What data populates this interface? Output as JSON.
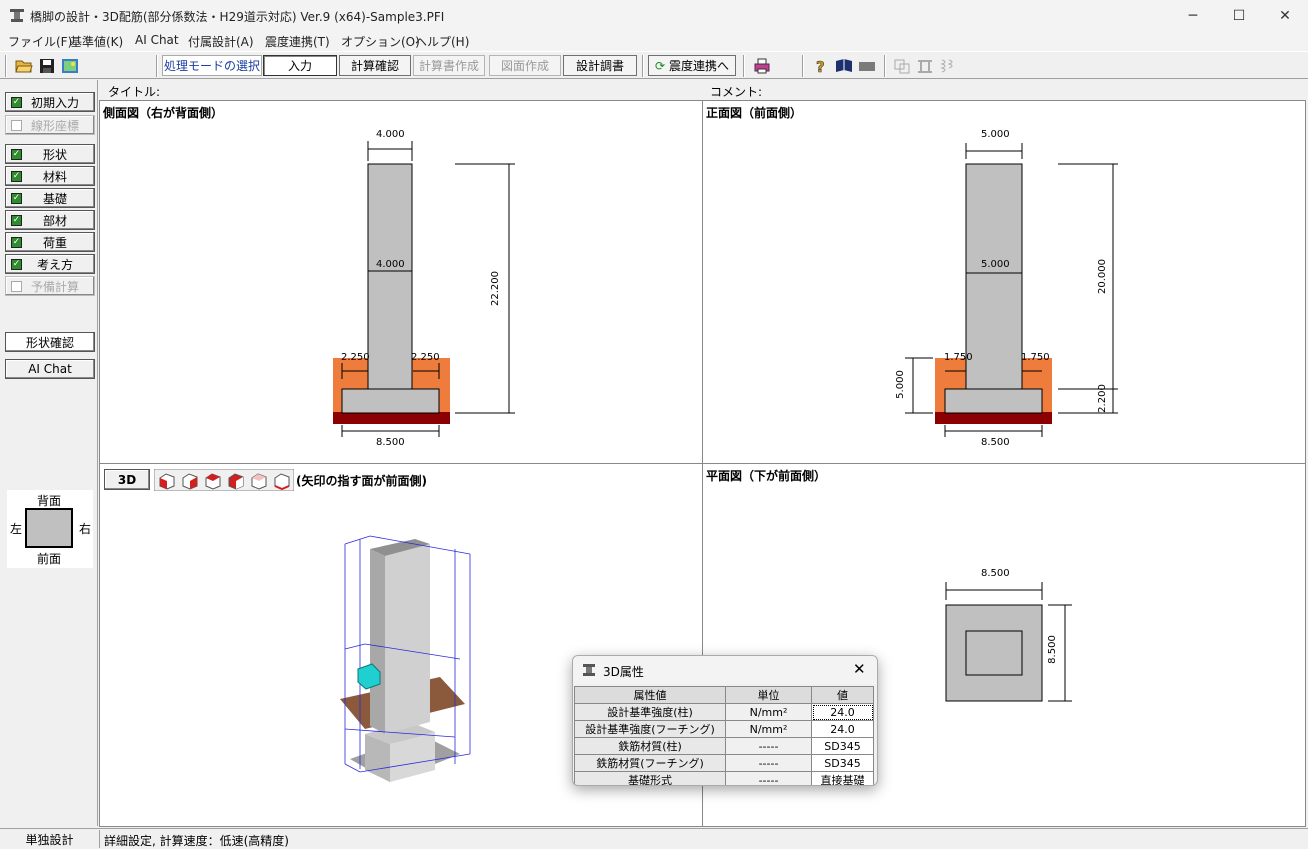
{
  "window": {
    "title": "橋脚の設計・3D配筋(部分係数法・H29道示対応) Ver.9 (x64)-Sample3.PFI",
    "minimize_glyph": "─",
    "maximize_glyph": "☐",
    "close_glyph": "✕"
  },
  "menu": [
    "ファイル(F)",
    "基準値(K)",
    "AI Chat",
    "付属設計(A)",
    "震度連携(T)",
    "オプション(O)",
    "ヘルプ(H)"
  ],
  "toolbar": {
    "mode_label": "処理モードの選択",
    "input": "入力",
    "calc_check": "計算確認",
    "report_create": "計算書作成",
    "drawing_create": "図面作成",
    "design_doc": "設計調書",
    "seismic_link": "震度連携へ"
  },
  "sidebar": {
    "items": [
      {
        "label": "初期入力",
        "checked": true,
        "enabled": true
      },
      {
        "label": "線形座標",
        "checked": false,
        "enabled": false
      },
      {
        "label": "形状",
        "checked": true,
        "enabled": true
      },
      {
        "label": "材料",
        "checked": true,
        "enabled": true
      },
      {
        "label": "基礎",
        "checked": true,
        "enabled": true
      },
      {
        "label": "部材",
        "checked": true,
        "enabled": true
      },
      {
        "label": "荷重",
        "checked": true,
        "enabled": true
      },
      {
        "label": "考え方",
        "checked": true,
        "enabled": true
      },
      {
        "label": "予備計算",
        "checked": false,
        "enabled": false
      }
    ],
    "shape_check": "形状確認",
    "ai_chat": "AI Chat",
    "orient": {
      "top": "背面",
      "bottom": "前面",
      "left": "左",
      "right": "右"
    }
  },
  "header": {
    "title_label": "タイトル:",
    "comment_label": "コメント:"
  },
  "views": {
    "side": {
      "title": "側面図（右が背面側）",
      "dims": {
        "top_width": "4.000",
        "mid_width": "4.000",
        "left_offset": "2.250",
        "right_offset": "2.250",
        "footing_width": "8.500",
        "height": "22.200"
      }
    },
    "front": {
      "title": "正面図（前面側）",
      "dims": {
        "top_width": "5.000",
        "mid_width": "5.000",
        "left_offset": "1.750",
        "right_offset": "1.750",
        "footing_width": "8.500",
        "pier_height": "20.000",
        "footing_height": "2.200",
        "soil_height": "5.000"
      }
    },
    "view3d": {
      "button": "3D",
      "note": "(矢印の指す面が前面側)"
    },
    "plan": {
      "title": "平面図（下が前面側）",
      "dims": {
        "width": "8.500",
        "depth": "8.500"
      }
    }
  },
  "colors": {
    "soil": "#ee7c3c",
    "base": "#8b0000",
    "concrete": "#c0c0c0",
    "selected_tab": "#ffffff"
  },
  "dialog": {
    "title": "3D属性",
    "columns": [
      "属性値",
      "単位",
      "値"
    ],
    "rows": [
      [
        "設計基準強度(柱)",
        "N/mm²",
        "24.0"
      ],
      [
        "設計基準強度(フーチング)",
        "N/mm²",
        "24.0"
      ],
      [
        "鉄筋材質(柱)",
        "-----",
        "SD345"
      ],
      [
        "鉄筋材質(フーチング)",
        "-----",
        "SD345"
      ],
      [
        "基礎形式",
        "-----",
        "直接基礎"
      ]
    ]
  },
  "status": {
    "mode": "単独設計",
    "detail": "詳細設定, 計算速度：低速(高精度)"
  }
}
